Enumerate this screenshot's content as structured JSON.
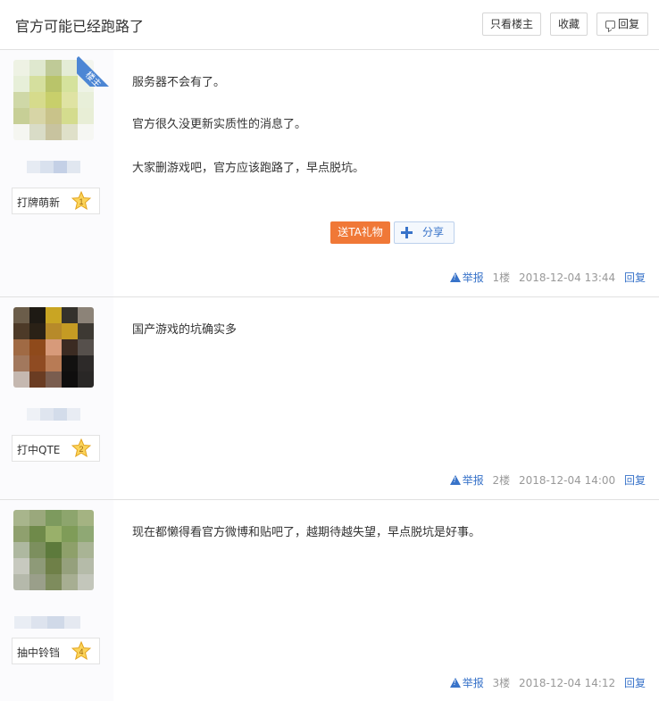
{
  "header": {
    "title": "官方可能已经跑路了",
    "btn_only_op": "只看楼主",
    "btn_favorite": "收藏",
    "btn_reply": "回复"
  },
  "posts": [
    {
      "badge_label": "打牌萌新",
      "level": "1",
      "is_op": true,
      "op_tag": "楼主",
      "lines": [
        "服务器不会有了。",
        "官方很久没更新实质性的消息了。",
        "大家删游戏吧，官方应该跑路了，早点脱坑。"
      ],
      "gift_label": "送TA礼物",
      "share_label": "分享",
      "report": "举报",
      "floor": "1楼",
      "time": "2018-12-04 13:44",
      "reply": "回复",
      "avatar_colors": [
        "#eef2e4",
        "#dfe8cf",
        "#bfca97",
        "#e4ecd6",
        "#f3f5ef",
        "#e7efd9",
        "#d5df9e",
        "#b9c46a",
        "#d5e29c",
        "#eef3e6",
        "#cfd8a7",
        "#d6db8c",
        "#c8cf6b",
        "#dfe3a3",
        "#e8efd9",
        "#c7cf96",
        "#d7d5a6",
        "#c9c38a",
        "#d4dc8e",
        "#e8eed6",
        "#f5f6f1",
        "#d9dcc7",
        "#c8c39f",
        "#dfe0c9",
        "#f6f7f3"
      ],
      "name_colors": [
        "#e6ebf3",
        "#d9e1ee",
        "#c4d0e6",
        "#e1e7f0"
      ]
    },
    {
      "badge_label": "打中QTE",
      "level": "2",
      "is_op": false,
      "lines": [
        "国产游戏的坑确实多"
      ],
      "report": "举报",
      "floor": "2楼",
      "time": "2018-12-04 14:00",
      "reply": "回复",
      "avatar_colors": [
        "#6b5d4a",
        "#1e1a14",
        "#c9a523",
        "#34312c",
        "#8c8378",
        "#4d3a28",
        "#2a2116",
        "#b78a2a",
        "#c59b23",
        "#3d3933",
        "#a06a44",
        "#8f4a1b",
        "#d79a7a",
        "#3b2b22",
        "#56504c",
        "#a2785d",
        "#8f4b22",
        "#b87b55",
        "#121110",
        "#2d2a29",
        "#c5b8b0",
        "#6a3c22",
        "#7a5d4f",
        "#0f0e0e",
        "#292726"
      ],
      "name_colors": [
        "#eef1f6",
        "#dfe5ef",
        "#d3dcea",
        "#e8ecf3"
      ]
    },
    {
      "badge_label": "抽中铃铛",
      "level": "4",
      "is_op": false,
      "lines": [
        "现在都懒得看官方微博和贴吧了，越期待越失望，早点脱坑是好事。"
      ],
      "report": "举报",
      "floor": "3楼",
      "time": "2018-12-04 14:12",
      "reply": "回复",
      "avatar_colors": [
        "#a8b58c",
        "#9aa87c",
        "#7d9a5e",
        "#8da56d",
        "#a4b382",
        "#8fa06e",
        "#6f8a4a",
        "#99b06a",
        "#7f9c58",
        "#8fa874",
        "#aeb8a0",
        "#7c8f5e",
        "#5d7a3c",
        "#8ea06a",
        "#a9b495",
        "#c7c9bf",
        "#8e9a78",
        "#6f8048",
        "#95a07c",
        "#b5bba9",
        "#b5b9ab",
        "#9a9f8a",
        "#7e8c5d",
        "#a7ae92",
        "#c3c6bb"
      ],
      "name_colors": [
        "#e9edf4",
        "#dde3ee",
        "#d0d9e8",
        "#e5e9f1"
      ]
    }
  ]
}
